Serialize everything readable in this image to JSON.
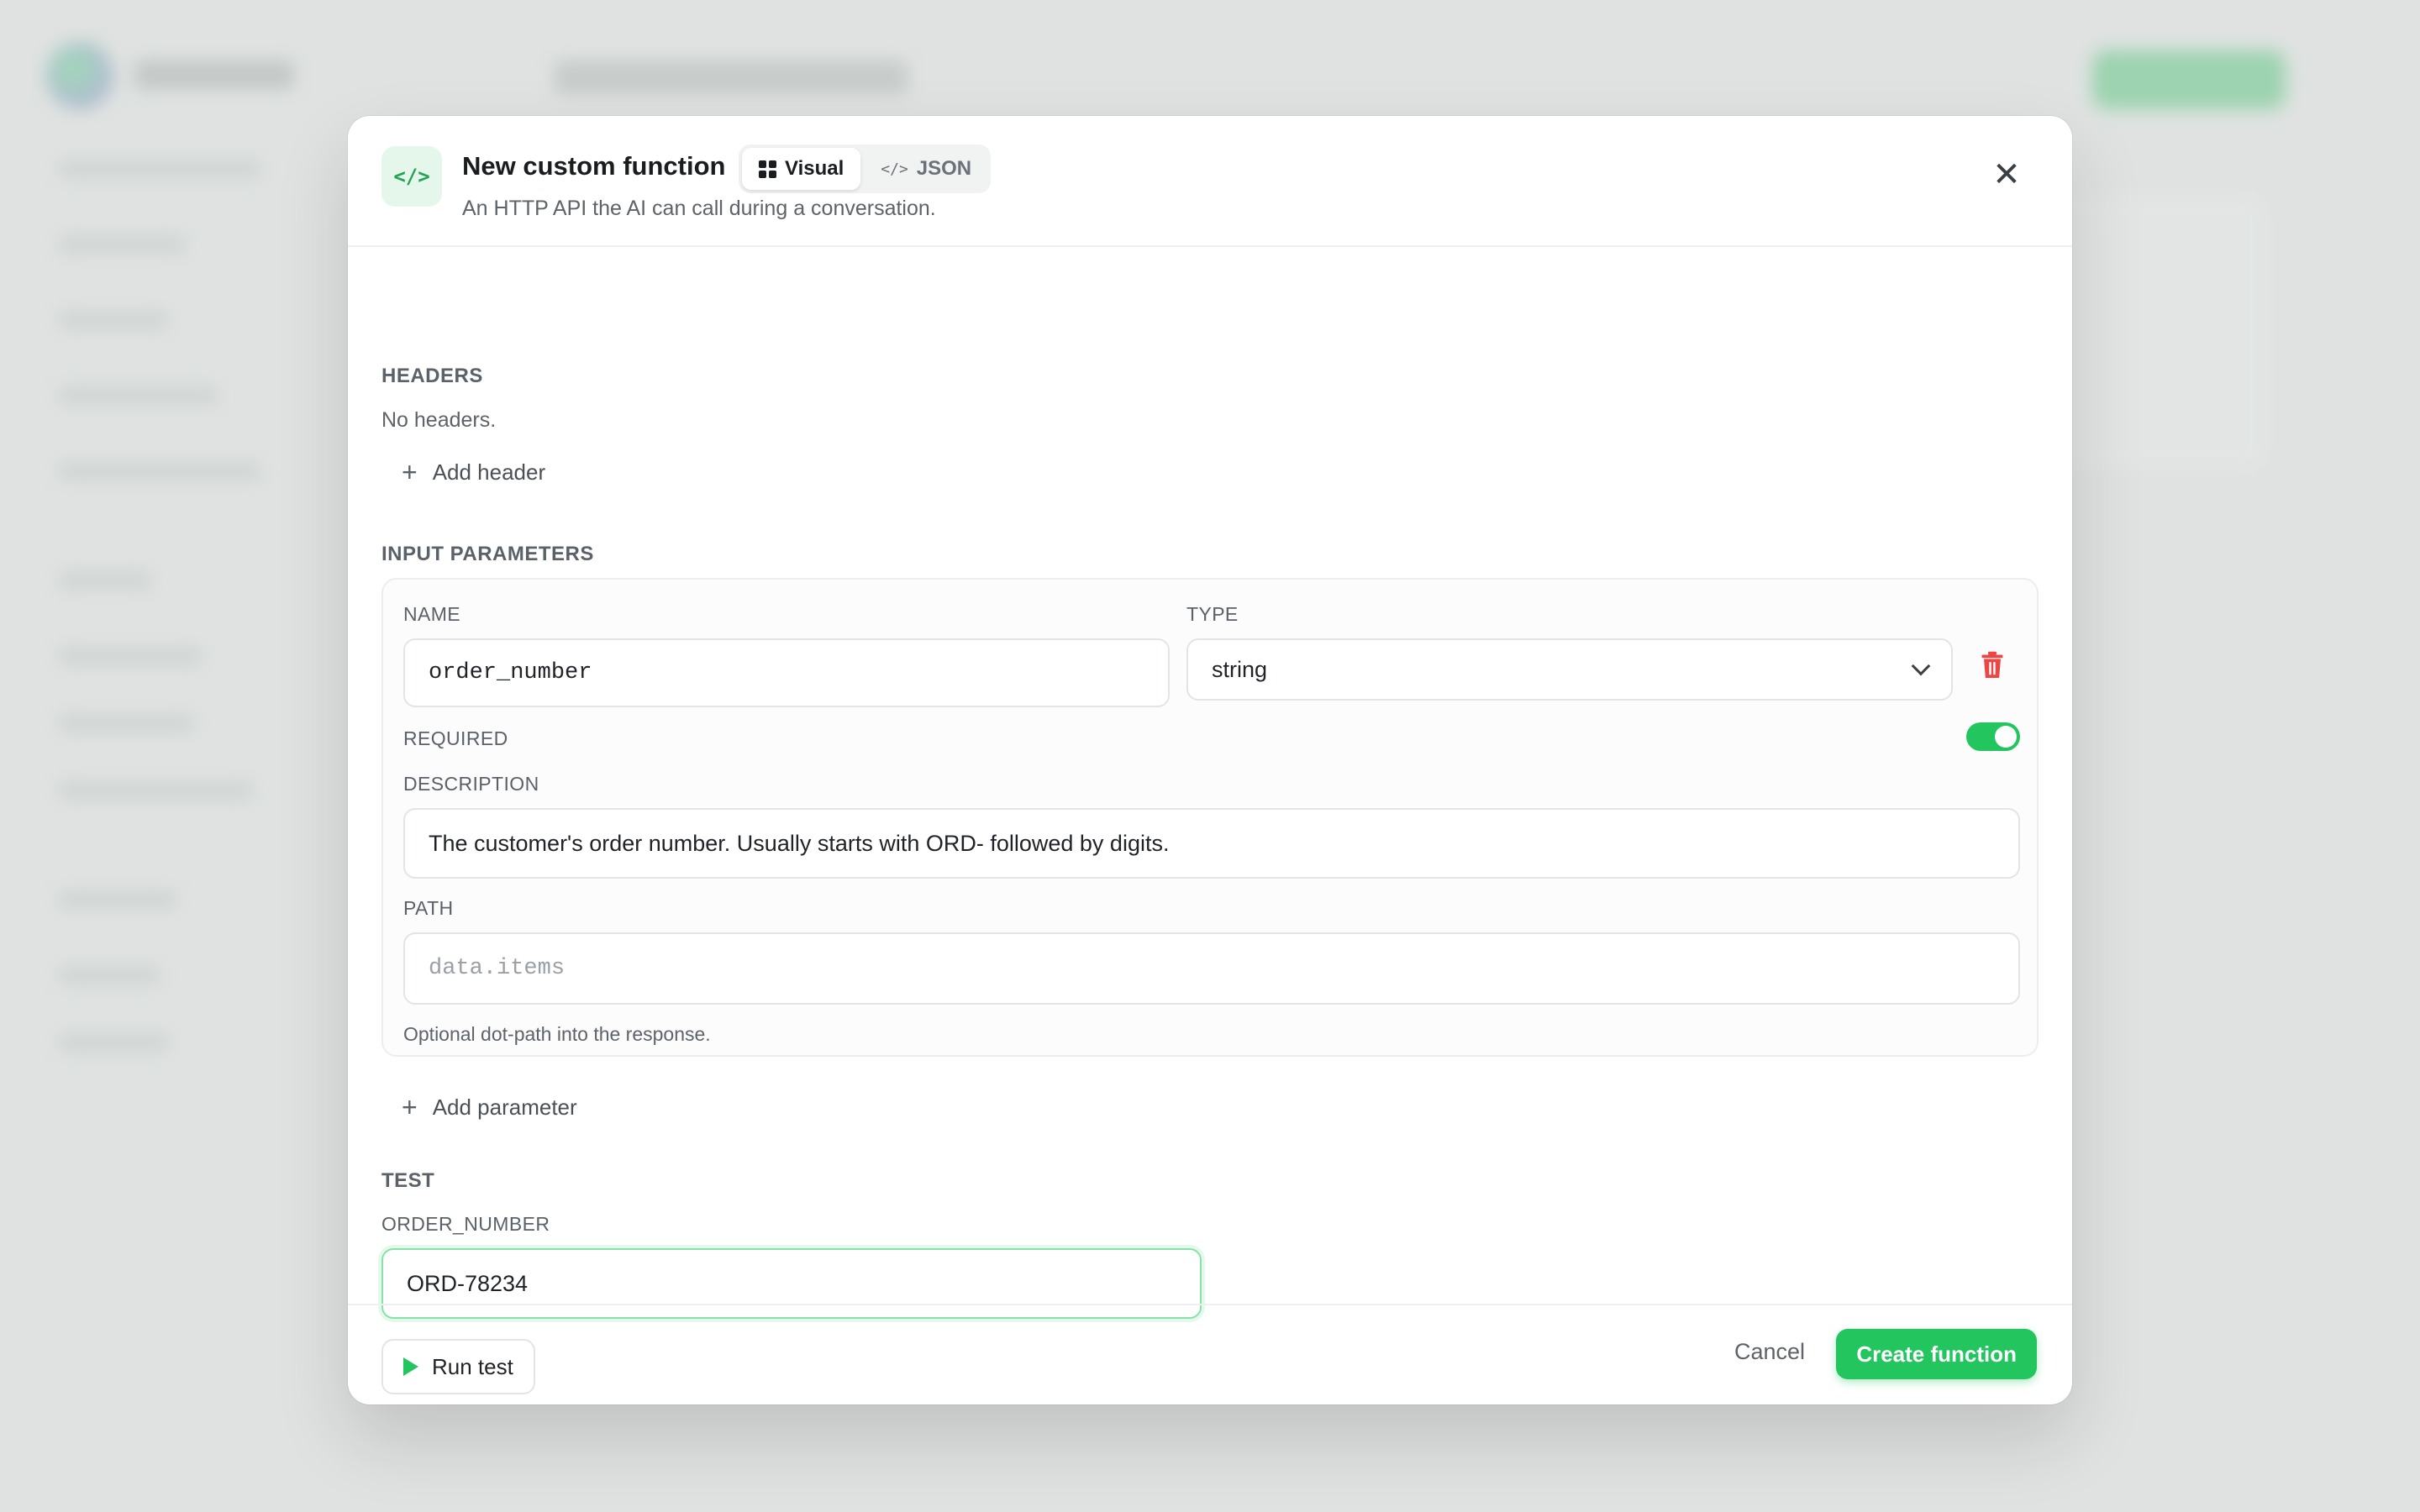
{
  "modal": {
    "title": "New custom function",
    "subtitle": "An HTTP API the AI can call during a conversation.",
    "icon": "code-icon",
    "tabs": [
      {
        "label": "Visual",
        "icon": "grid-icon",
        "active": true
      },
      {
        "label": "JSON",
        "icon": "code-icon",
        "active": false
      }
    ]
  },
  "headers": {
    "label": "HEADERS",
    "empty_text": "No headers.",
    "add_label": "Add header"
  },
  "params": {
    "label": "INPUT PARAMETERS",
    "name_label": "NAME",
    "name_value": "order_number",
    "type_label": "TYPE",
    "type_value": "string",
    "required_label": "REQUIRED",
    "required": true,
    "description_label": "DESCRIPTION",
    "description_value": "The customer's order number. Usually starts with ORD- followed by digits.",
    "path_label": "PATH",
    "path_placeholder": "data.items",
    "path_hint": "Optional dot-path into the response.",
    "add_label": "Add parameter"
  },
  "test": {
    "label": "TEST",
    "field_label": "ORDER_NUMBER",
    "field_value": "ORD-78234",
    "run_label": "Run test"
  },
  "footer": {
    "cancel_label": "Cancel",
    "create_label": "Create function"
  },
  "colors": {
    "accent": "#22c55e",
    "danger": "#ef4444"
  }
}
